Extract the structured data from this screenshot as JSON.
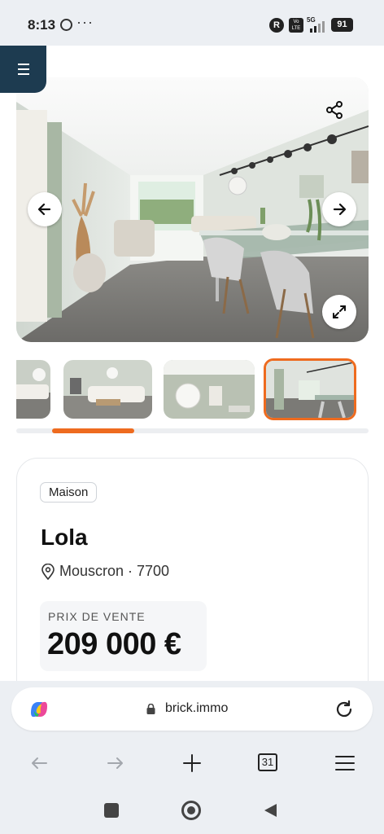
{
  "status_bar": {
    "time": "8:13",
    "dots": "···",
    "r_badge": "R",
    "volte": "Vo LTE",
    "network": "5G",
    "battery": "91"
  },
  "listing": {
    "type_badge": "Maison",
    "name": "Lola",
    "location": "Mouscron · 7700",
    "price_label": "PRIX DE VENTE",
    "price_value": "209 000 €"
  },
  "gallery": {
    "photo_count_shown": 4,
    "active_thumb_index": 3,
    "scroll_position_fraction": 0.1
  },
  "browser": {
    "url": "brick.immo",
    "tabs_count": "31"
  },
  "colors": {
    "accent": "#ee6b1f",
    "menu_bg": "#1d3b50",
    "page_bg": "#ffffff",
    "chrome_bg": "#eceff3"
  },
  "icons": [
    "menu-icon",
    "share-icon",
    "arrow-left-icon",
    "arrow-right-icon",
    "expand-icon",
    "map-pin-icon",
    "lock-icon",
    "reload-icon",
    "back-icon",
    "forward-icon",
    "plus-icon",
    "tabs-icon",
    "hamburger-icon",
    "copilot-icon",
    "square-icon",
    "home-circle-icon",
    "back-triangle-icon"
  ]
}
